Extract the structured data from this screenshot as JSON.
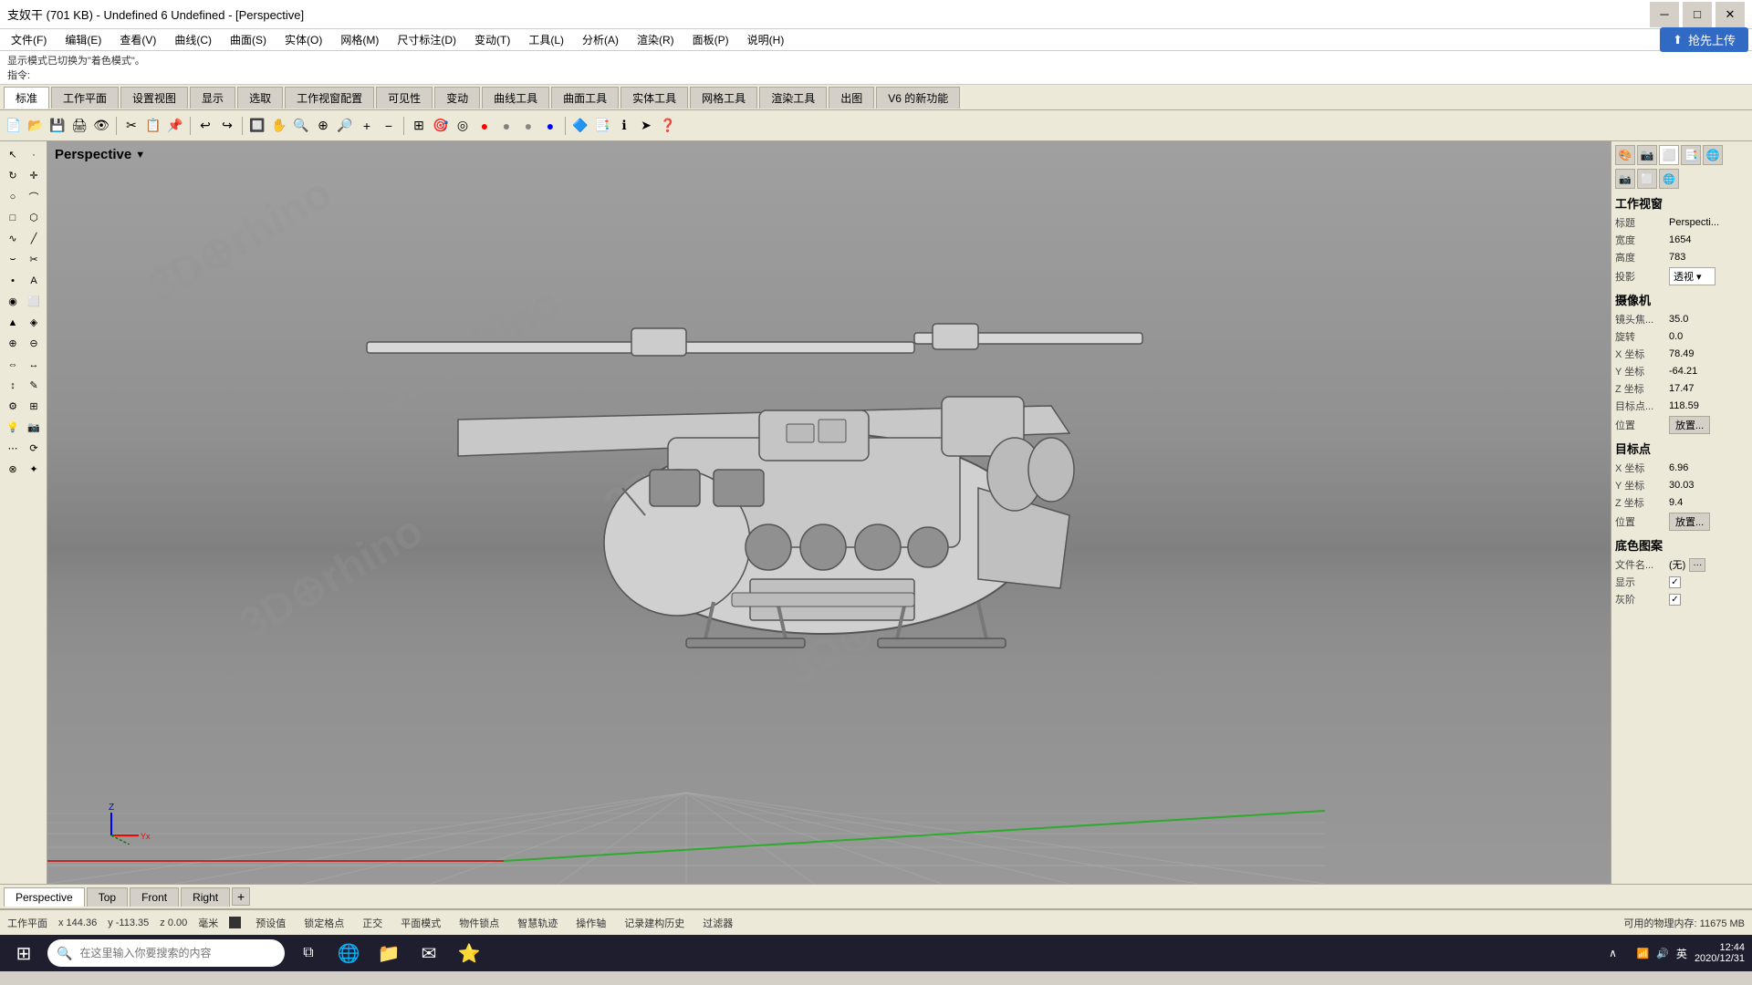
{
  "title_bar": {
    "title": "支奴干 (701 KB) - Undefined 6 Undefined - [Perspective]",
    "min_label": "─",
    "max_label": "□",
    "close_label": "✕"
  },
  "menu_bar": {
    "items": [
      "文件(F)",
      "编辑(E)",
      "查看(V)",
      "曲线(C)",
      "曲面(S)",
      "实体(O)",
      "网格(M)",
      "尺寸标注(D)",
      "变动(T)",
      "工具(L)",
      "分析(A)",
      "渲染(R)",
      "面板(P)",
      "说明(H)"
    ]
  },
  "info_bar": {
    "line1": "显示模式已切换为\"着色模式\"。",
    "prompt": "指令:"
  },
  "tabs": {
    "items": [
      "标准",
      "工作平面",
      "设置视图",
      "显示",
      "选取",
      "工作视窗配置",
      "可见性",
      "变动",
      "曲线工具",
      "曲面工具",
      "实体工具",
      "网格工具",
      "渲染工具",
      "出图",
      "V6 的新功能"
    ]
  },
  "viewport": {
    "label": "Perspective",
    "dropdown_icon": "▼"
  },
  "bottom_tabs": {
    "tabs": [
      "Perspective",
      "Top",
      "Front",
      "Right"
    ],
    "add_icon": "+"
  },
  "status_bar": {
    "plane": "工作平面",
    "x": "x 144.36",
    "y": "y -113.35",
    "z": "z 0.00",
    "unit": "毫米",
    "dot_color": "#333",
    "items": [
      "预设值",
      "锁定格点",
      "正交",
      "平面模式",
      "物件锁点",
      "智慧轨迹",
      "操作轴",
      "记录建构历史",
      "过滤器"
    ],
    "memory": "可用的物理内存: 11675 MB"
  },
  "right_panel": {
    "title": "工作视窗",
    "icons": [
      "🎨",
      "⬜",
      "🌐"
    ],
    "sub_icons": [
      "📷",
      "⬜",
      "🌐"
    ],
    "rows": [
      {
        "label": "标题",
        "value": "Perspecti..."
      },
      {
        "label": "宽度",
        "value": "1654"
      },
      {
        "label": "高度",
        "value": "783"
      },
      {
        "label": "投影",
        "value": "透视"
      }
    ],
    "camera_title": "摄像机",
    "camera_rows": [
      {
        "label": "镜头焦...",
        "value": "35.0"
      },
      {
        "label": "旋转",
        "value": "0.0"
      },
      {
        "label": "X 坐标",
        "value": "78.49"
      },
      {
        "label": "Y 坐标",
        "value": "-64.21"
      },
      {
        "label": "Z 坐标",
        "value": "17.47"
      },
      {
        "label": "目标点...",
        "value": "118.59"
      }
    ],
    "camera_position_btn": "放置...",
    "target_title": "目标点",
    "target_rows": [
      {
        "label": "X 坐标",
        "value": "6.96"
      },
      {
        "label": "Y 坐标",
        "value": "30.03"
      },
      {
        "label": "Z 坐标",
        "value": "9.4"
      }
    ],
    "target_position_label": "位置",
    "target_position_btn": "放置...",
    "bg_title": "底色图案",
    "bg_rows": [
      {
        "label": "文件名...",
        "value": "(无)"
      },
      {
        "label": "显示",
        "checked": true
      },
      {
        "label": "灰阶",
        "checked": true
      }
    ]
  },
  "taskbar": {
    "search_placeholder": "在这里输入你要搜索的内容",
    "clock_time": "12:44",
    "clock_date": "2020/12/31",
    "upload_btn": "抢先上传",
    "lang": "英"
  }
}
